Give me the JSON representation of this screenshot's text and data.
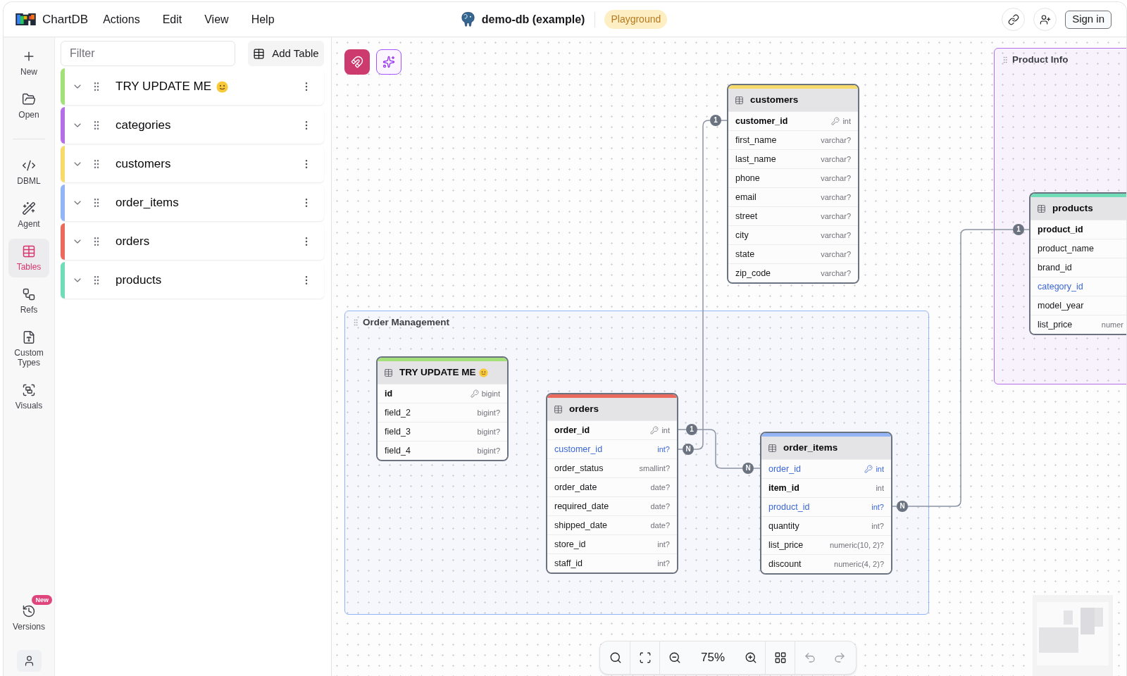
{
  "app": {
    "brand": "ChartDB",
    "menu": [
      "Actions",
      "Edit",
      "View",
      "Help"
    ]
  },
  "diagram": {
    "title": "demo-db (example)",
    "badge": "Playground",
    "sign_in": "Sign in"
  },
  "sidebar": {
    "top": [
      {
        "label": "New",
        "selected": false
      },
      {
        "label": "Open",
        "selected": false
      }
    ],
    "main": [
      {
        "label": "DBML",
        "selected": false
      },
      {
        "label": "Agent",
        "selected": false
      },
      {
        "label": "Tables",
        "selected": true
      },
      {
        "label": "Refs",
        "selected": false
      },
      {
        "label": "Custom Types",
        "selected": false
      },
      {
        "label": "Visuals",
        "selected": false
      }
    ],
    "bottom": [
      {
        "label": "Versions",
        "selected": false,
        "badge": "New"
      }
    ]
  },
  "tables_panel": {
    "filter": {
      "placeholder": "Filter"
    },
    "add_button": "Add Table",
    "tables": [
      {
        "name": "TRY UPDATE ME",
        "emoji": true,
        "color": "#a3e07a"
      },
      {
        "name": "categories",
        "emoji": false,
        "color": "#b46ee6"
      },
      {
        "name": "customers",
        "emoji": false,
        "color": "#f6da6b"
      },
      {
        "name": "order_items",
        "emoji": false,
        "color": "#93b4f5"
      },
      {
        "name": "orders",
        "emoji": false,
        "color": "#ea6a5e"
      },
      {
        "name": "products",
        "emoji": false,
        "color": "#72dcb8"
      }
    ]
  },
  "canvas": {
    "areas": [
      {
        "name": "Product Info",
        "color": "#b46ee6"
      },
      {
        "name": "Order Management",
        "color": "#93b4f5"
      }
    ],
    "tables": [
      {
        "name": "customers",
        "emoji": false,
        "color": "#f6da6b",
        "fields": [
          {
            "name": "customer_id",
            "type": "int",
            "kind": "primary"
          },
          {
            "name": "first_name",
            "type": "varchar?",
            "kind": "plain"
          },
          {
            "name": "last_name",
            "type": "varchar?",
            "kind": "plain"
          },
          {
            "name": "phone",
            "type": "varchar?",
            "kind": "plain"
          },
          {
            "name": "email",
            "type": "varchar?",
            "kind": "plain"
          },
          {
            "name": "street",
            "type": "varchar?",
            "kind": "plain"
          },
          {
            "name": "city",
            "type": "varchar?",
            "kind": "plain"
          },
          {
            "name": "state",
            "type": "varchar?",
            "kind": "plain"
          },
          {
            "name": "zip_code",
            "type": "varchar?",
            "kind": "plain"
          }
        ]
      },
      {
        "name": "products",
        "emoji": false,
        "color": "#72dcb8",
        "fields": [
          {
            "name": "product_id",
            "kind": "primary"
          },
          {
            "name": "product_name",
            "kind": "plain"
          },
          {
            "name": "brand_id",
            "kind": "plain"
          },
          {
            "name": "category_id",
            "kind": "foreign"
          },
          {
            "name": "model_year",
            "kind": "plain"
          },
          {
            "name": "list_price",
            "type": "numer",
            "kind": "plain"
          }
        ]
      },
      {
        "name": "TRY UPDATE ME",
        "emoji": true,
        "color": "#a3e07a",
        "fields": [
          {
            "name": "id",
            "type": "bigint",
            "kind": "primary"
          },
          {
            "name": "field_2",
            "type": "bigint?",
            "kind": "plain"
          },
          {
            "name": "field_3",
            "type": "bigint?",
            "kind": "plain"
          },
          {
            "name": "field_4",
            "type": "bigint?",
            "kind": "plain"
          }
        ]
      },
      {
        "name": "orders",
        "emoji": false,
        "color": "#ea6a5e",
        "fields": [
          {
            "name": "order_id",
            "type": "int",
            "kind": "primary"
          },
          {
            "name": "customer_id",
            "type": "int?",
            "kind": "foreign"
          },
          {
            "name": "order_status",
            "type": "smallint?",
            "kind": "plain"
          },
          {
            "name": "order_date",
            "type": "date?",
            "kind": "plain"
          },
          {
            "name": "required_date",
            "type": "date?",
            "kind": "plain"
          },
          {
            "name": "shipped_date",
            "type": "date?",
            "kind": "plain"
          },
          {
            "name": "store_id",
            "type": "int?",
            "kind": "plain"
          },
          {
            "name": "staff_id",
            "type": "int?",
            "kind": "plain"
          }
        ]
      },
      {
        "name": "order_items",
        "emoji": false,
        "color": "#93b4f5",
        "fields": [
          {
            "name": "order_id",
            "type": "int",
            "kind": "foreign_key"
          },
          {
            "name": "item_id",
            "type": "int",
            "kind": "composite"
          },
          {
            "name": "product_id",
            "type": "int?",
            "kind": "foreign"
          },
          {
            "name": "quantity",
            "type": "int?",
            "kind": "plain"
          },
          {
            "name": "list_price",
            "type": "numeric(10, 2)?",
            "kind": "plain"
          },
          {
            "name": "discount",
            "type": "numeric(4, 2)?",
            "kind": "plain"
          }
        ]
      }
    ],
    "relationships": [
      {
        "from": "1",
        "to": "N"
      },
      {
        "from": "1",
        "to": "N"
      },
      {
        "from": "N",
        "to": "1"
      }
    ],
    "toolbar": {
      "zoom": "75%"
    }
  }
}
